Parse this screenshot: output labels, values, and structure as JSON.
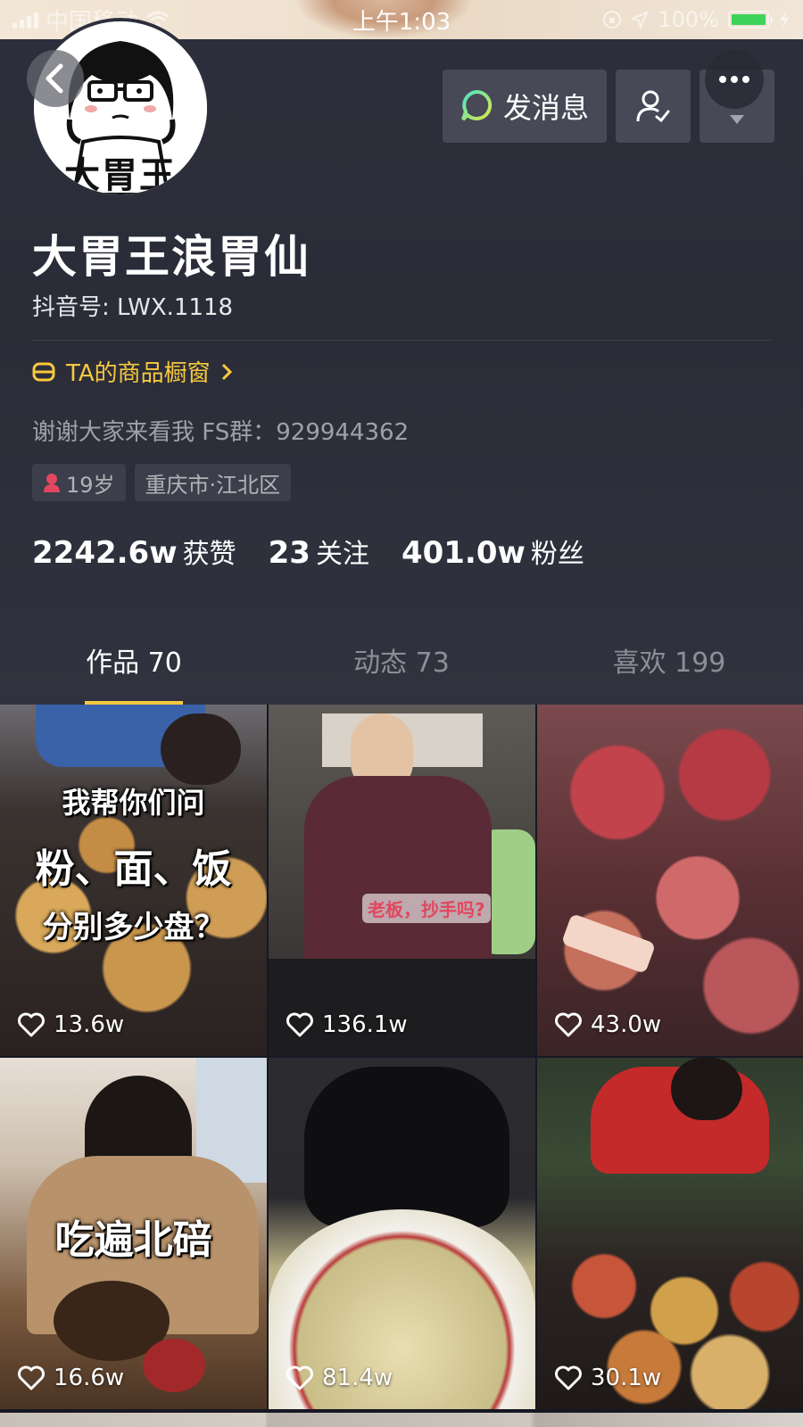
{
  "status_bar": {
    "carrier": "中国移动",
    "time": "上午1:03",
    "battery": "100%"
  },
  "profile": {
    "avatar_text": "大胃王",
    "name": "大胃王浪胃仙",
    "douyin_id": "抖音号: LWX.1118",
    "shop_link": "TA的商品橱窗",
    "bio": "谢谢大家来看我 FS群：929944362",
    "tags": {
      "age": "19岁",
      "location": "重庆市·江北区"
    },
    "stats": {
      "likes_num": "2242.6w",
      "likes_label": "获赞",
      "following_num": "23",
      "following_label": "关注",
      "fans_num": "401.0w",
      "fans_label": "粉丝"
    }
  },
  "actions": {
    "message_label": "发消息"
  },
  "tabs": [
    {
      "label": "作品 70",
      "active": true
    },
    {
      "label": "动态 73",
      "active": false
    },
    {
      "label": "喜欢 199",
      "active": false
    }
  ],
  "videos": [
    {
      "likes": "13.6w",
      "overlay": [
        "我帮你们问",
        "粉、面、饭",
        "分别多少盘？"
      ]
    },
    {
      "likes": "136.1w",
      "overlay": [
        "老板，抄手吗?"
      ]
    },
    {
      "likes": "43.0w",
      "overlay": []
    },
    {
      "likes": "16.6w",
      "overlay": [
        "吃遍北碚"
      ]
    },
    {
      "likes": "81.4w",
      "overlay": []
    },
    {
      "likes": "30.1w",
      "overlay": []
    }
  ],
  "colors": {
    "accent": "#f8c93e",
    "background": "#161823",
    "button": "#474956"
  }
}
